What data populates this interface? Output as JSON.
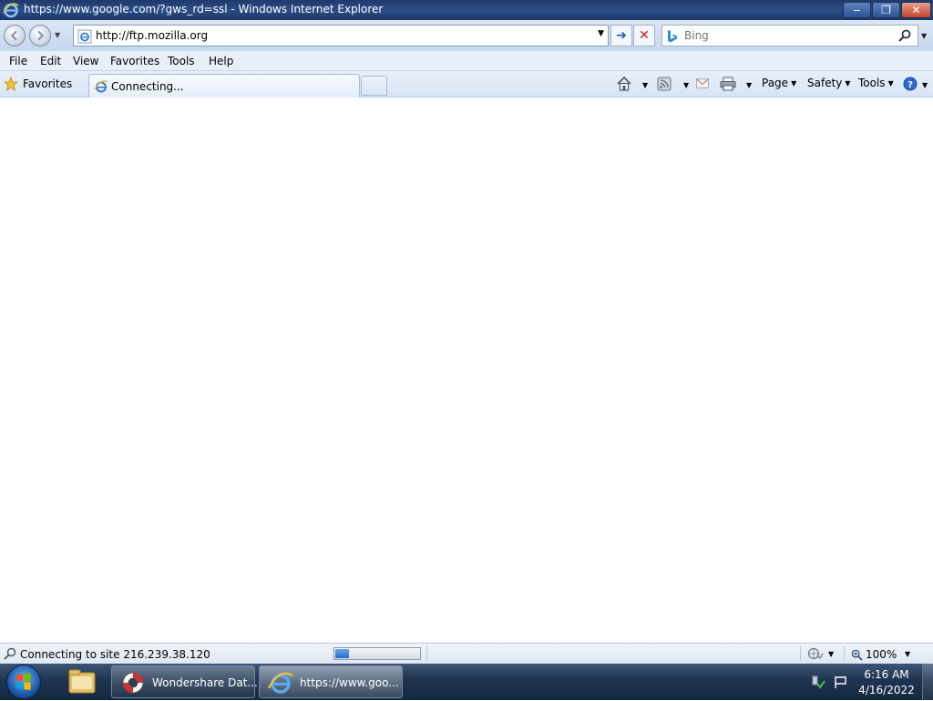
{
  "window": {
    "title": "https://www.google.com/?gws_rd=ssl - Windows Internet Explorer",
    "minimize_label": "‒",
    "restore_label": "❐",
    "close_label": "✕"
  },
  "address_bar": {
    "url": "http://ftp.mozilla.org",
    "go_label": "➔",
    "stop_label": "✕"
  },
  "search": {
    "placeholder": "Bing"
  },
  "menu": {
    "items": [
      {
        "label": "File"
      },
      {
        "label": "Edit"
      },
      {
        "label": "View"
      },
      {
        "label": "Favorites"
      },
      {
        "label": "Tools"
      },
      {
        "label": "Help"
      }
    ]
  },
  "favorites_bar": {
    "favorites_label": "Favorites"
  },
  "tabs": {
    "active_label": "Connecting..."
  },
  "command_bar": {
    "page_label": "Page",
    "safety_label": "Safety",
    "tools_label": "Tools"
  },
  "status_bar": {
    "text": "Connecting to site 216.239.38.120",
    "progress_fraction": 0.16,
    "zoom_label": "100%"
  },
  "taskbar": {
    "wondershare_label": "Wondershare Dat...",
    "ie_label": "https://www.goo...",
    "time": "6:16 AM",
    "date": "4/16/2022"
  },
  "icons": {
    "browser": "ie-icon",
    "home": "home-icon",
    "feeds": "rss-icon",
    "mail": "mail-icon",
    "print": "print-icon",
    "help": "help-icon",
    "search": "magnifier-icon",
    "favorites": "star-icon"
  },
  "colors": {
    "titlebar": "#1f3a6b",
    "accent": "#1f57b5",
    "stop": "#c8201b",
    "taskbar": "#1e3450"
  }
}
